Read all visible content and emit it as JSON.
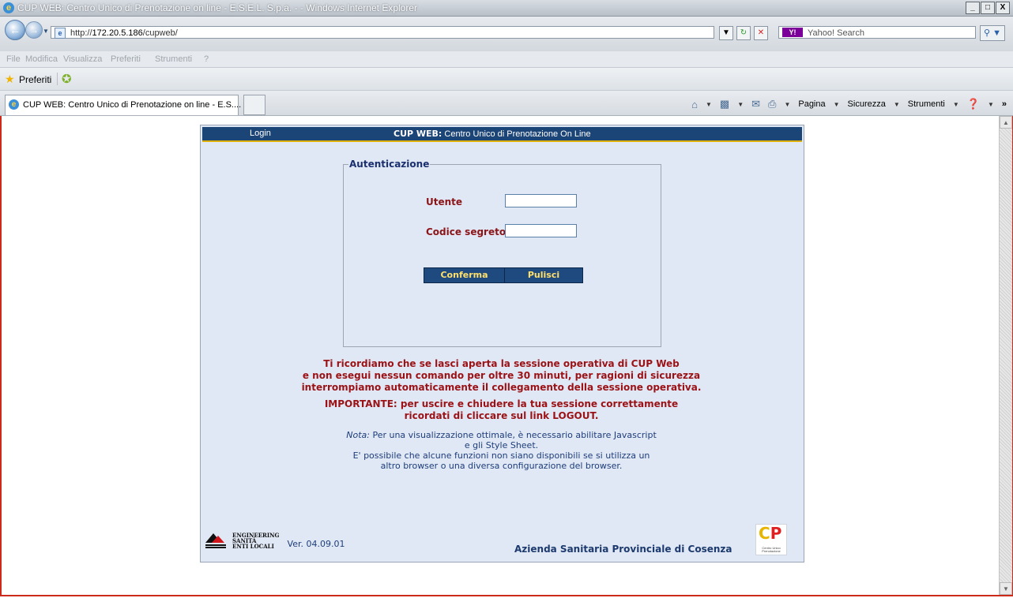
{
  "window": {
    "title": "CUP WEB: Centro Unico di Prenotazione on line - E.S.E.L. S.p.a. - - Windows Internet Explorer",
    "controls": [
      "_",
      "&#9633;",
      "X"
    ]
  },
  "addressbar": {
    "url_prefix": "http://",
    "url_host": "172.20.5.186",
    "url_path": "/cupweb/",
    "search_placeholder": "Yahoo! Search"
  },
  "menubar": {
    "items": [
      "File",
      "Modifica",
      "Visualizza",
      "Preferiti",
      "Strumenti",
      "?"
    ]
  },
  "favorites": {
    "label": "Preferiti"
  },
  "tab": {
    "title": "CUP WEB: Centro Unico di Prenotazione on line - E.S...."
  },
  "commandbar": {
    "pagina": "Pagina",
    "sicurezza": "Sicurezza",
    "strumenti": "Strumenti"
  },
  "page": {
    "header_login": "Login",
    "header_title_bold": "CUP WEB:",
    "header_title_rest": " Centro Unico di Prenotazione On Line",
    "auth_legend": "Autenticazione",
    "user_label": "Utente",
    "user_value": "",
    "password_label": "Codice segreto",
    "password_value": "",
    "confirm_button": "Conferma",
    "clear_button": "Pulisci",
    "warning_lines": [
      "Ti ricordiamo che se lasci aperta la sessione operativa di CUP Web",
      "e non esegui nessun comando per oltre 30 minuti, per ragioni di sicurezza",
      "interrompiamo automaticamente il collegamento della sessione operativa."
    ],
    "important_lines": [
      "IMPORTANTE: per uscire e chiudere la tua sessione correttamente",
      "ricordati di cliccare sul link LOGOUT."
    ],
    "note_label": "Nota:",
    "note_lines": [
      " Per una visualizzazione ottimale, è necessario abilitare Javascript",
      "e gli Style Sheet.",
      "E' possibile che alcune funzioni non siano disponibili se si utilizza un",
      "altro browser o una diversa configurazione del browser."
    ],
    "eng_brand_lines": [
      "ENGINEERING",
      "SANITÀ",
      "ENTI LOCALI"
    ],
    "version": "Ver. 04.09.01",
    "azienda": "Azienda Sanitaria Provinciale di Cosenza",
    "cup_logo_text": "Centro Unico Prenotazione"
  },
  "colors": {
    "header_blue": "#1c4577",
    "panel_bg": "#e1e8f5",
    "warn_red": "#9b1216",
    "button_text": "#ffe06a"
  }
}
